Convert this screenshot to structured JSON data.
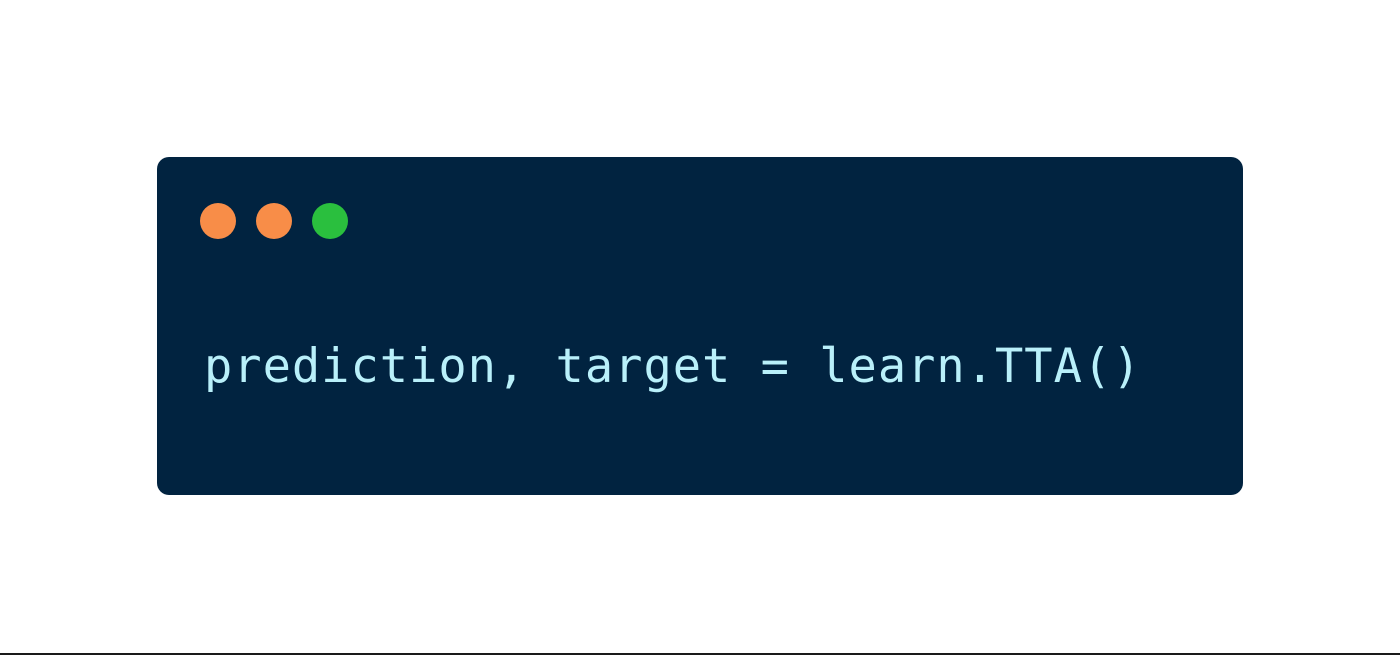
{
  "window": {
    "background_color": "#012340",
    "controls": [
      {
        "name": "close-dot-icon",
        "color": "#F88D48"
      },
      {
        "name": "minimize-dot-icon",
        "color": "#F88D48"
      },
      {
        "name": "maximize-dot-icon",
        "color": "#2ABF3E"
      }
    ]
  },
  "code": {
    "line": "prediction, target = learn.TTA()",
    "text_color": "#B9F0FA"
  }
}
